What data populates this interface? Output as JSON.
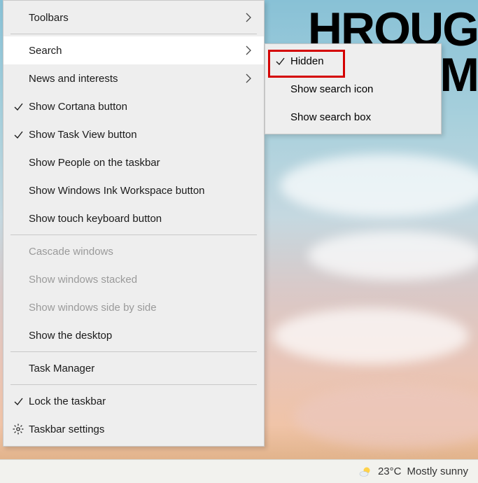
{
  "background": {
    "text_line1": "HROUG",
    "text_line2": "M"
  },
  "menu": {
    "toolbars": "Toolbars",
    "search": "Search",
    "news": "News and interests",
    "cortana": "Show Cortana button",
    "taskview": "Show Task View button",
    "people": "Show People on the taskbar",
    "ink": "Show Windows Ink Workspace button",
    "touchkb": "Show touch keyboard button",
    "cascade": "Cascade windows",
    "stacked": "Show windows stacked",
    "sidebyside": "Show windows side by side",
    "desktop": "Show the desktop",
    "taskmgr": "Task Manager",
    "lock": "Lock the taskbar",
    "settings": "Taskbar settings"
  },
  "submenu": {
    "hidden": "Hidden",
    "icon": "Show search icon",
    "box": "Show search box"
  },
  "taskbar": {
    "temp": "23°C",
    "condition": "Mostly sunny"
  }
}
